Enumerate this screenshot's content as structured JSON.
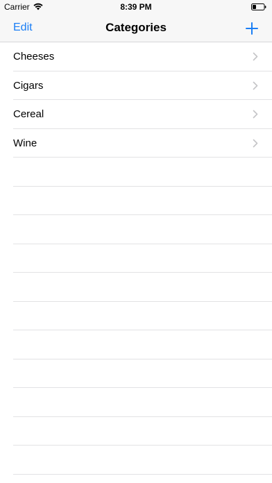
{
  "status_bar": {
    "carrier": "Carrier",
    "time": "8:39 PM",
    "icons": [
      "wifi-icon",
      "battery-icon"
    ]
  },
  "nav": {
    "edit_label": "Edit",
    "title": "Categories",
    "add_icon": "plus-icon"
  },
  "categories": [
    {
      "label": "Cheeses"
    },
    {
      "label": "Cigars"
    },
    {
      "label": "Cereal"
    },
    {
      "label": "Wine"
    }
  ],
  "colors": {
    "accent": "#1a7ef5",
    "chevron": "#c4c4c7",
    "separator": "#e2e2e4",
    "bar_background": "#f7f7f7"
  }
}
